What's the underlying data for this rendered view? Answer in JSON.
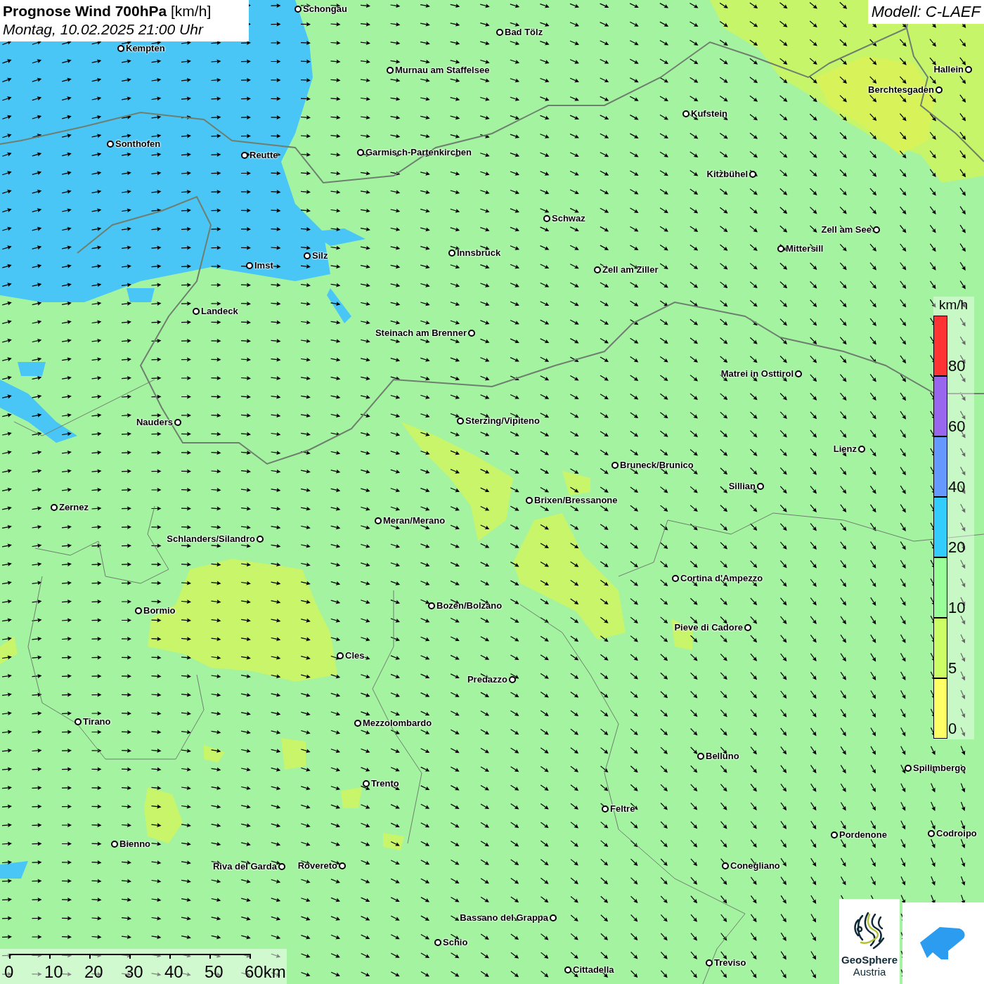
{
  "header": {
    "title": "**Prognose Wind 700hPa** [km/h]",
    "subtitle": "Montag, 10.02.2025 21:00 Uhr"
  },
  "model": "Modell: C-LAEF",
  "cities": [
    "Schongau",
    "Kempten",
    "Bad Tölz",
    "Murnau am Staffelsee",
    "Hallein",
    "Berchtesgaden",
    "Kufstein",
    "Sonthofen",
    "Reutte",
    "Garmisch-Partenkirchen",
    "Kitzbühel",
    "Schwaz",
    "Zell am See",
    "Mittersill",
    "Innsbruck",
    "Silz",
    "Imst",
    "Zell am Ziller",
    "Landeck",
    "Steinach am Brenner",
    "Matrei in Osttirol",
    "Nauders",
    "Sterzing/Vipiteno",
    "Lienz",
    "Bruneck/Brunico",
    "Sillian",
    "Brixen/Bressanone",
    "Zernez",
    "Meran/Merano",
    "Schlanders/Silandro",
    "Cortina d'Ampezzo",
    "Bozen/Bolzano",
    "Bormio",
    "Pieve di Cadore",
    "Cles",
    "Predazzo",
    "Tirano",
    "Mezzolombardo",
    "Belluno",
    "Spilimbergo",
    "Trento",
    "Feltre",
    "Pordenone",
    "Codroipo",
    "Bienno",
    "Riva del Garda",
    "Rovereto",
    "Conegliano",
    "Bassano del Grappa",
    "Schio",
    "Treviso",
    "Cittadella"
  ],
  "legend": {
    "unit": "km/h",
    "bands": [
      {
        "label": "80",
        "color": "#ff3333"
      },
      {
        "label": "60",
        "color": "#9966ee"
      },
      {
        "label": "40",
        "color": "#6699ff"
      },
      {
        "label": "20",
        "color": "#33ccff"
      },
      {
        "label": "10",
        "color": "#99ff99"
      },
      {
        "label": "5",
        "color": "#ccff66"
      },
      {
        "label": "0",
        "color": "#ffff66"
      }
    ]
  },
  "scale": [
    "0",
    "10",
    "20",
    "30",
    "40",
    "50",
    "60km"
  ],
  "logo": {
    "line1": "GeoSphere",
    "line2": "Austria"
  }
}
